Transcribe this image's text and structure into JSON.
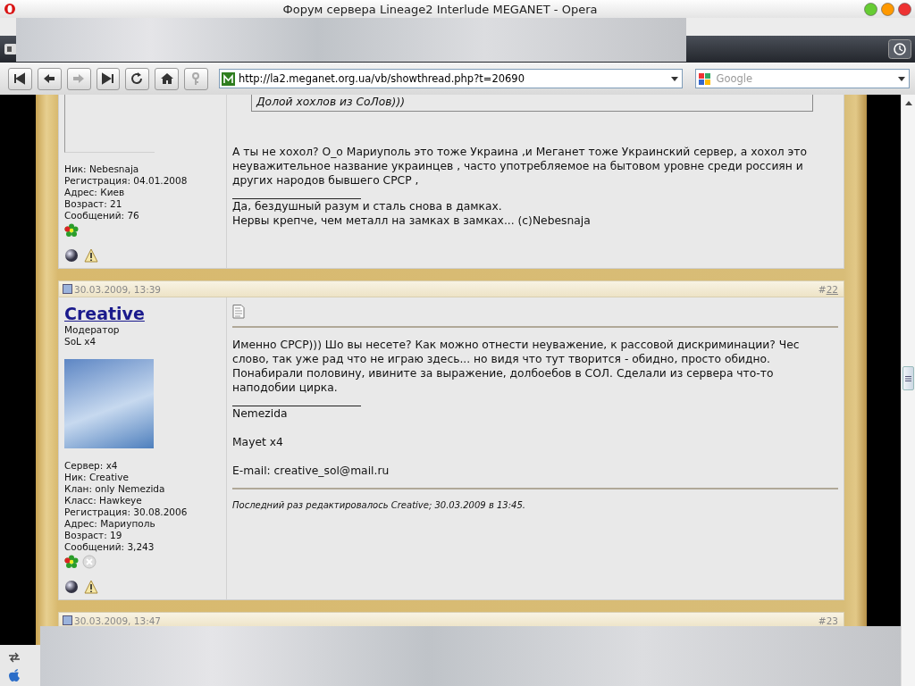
{
  "window": {
    "title": "Форум сервера Lineage2 Interlude MEGANET - Opera"
  },
  "toolbar": {
    "address": "http://la2.meganet.org.ua/vb/showthread.php?t=20690",
    "search": {
      "placeholder": "Google"
    }
  },
  "posts": [
    {
      "user_info": [
        "Ник: Nebesnaja",
        "Регистрация: 04.01.2008",
        "Адрес: Киев",
        "Возраст: 21",
        "Сообщений: 76"
      ],
      "contacts": [
        {
          "kind": "flower"
        }
      ],
      "quote": "Долой хохлов из СоЛов)))",
      "message": "А ты не хохол? О_о Мариуполь это тоже Украина ,и Меганет тоже Украинский сервер, а хохол это неуважительное название украинцев , часто употребляемое на бытовом уровне среди россиян и других народов бывшего СРСР ,",
      "signature": [
        "Да, бездушный разум и сталь снова в дамках.\nНервы крепче, чем металл на замках в замках... (c)Nebesnaja"
      ]
    },
    {
      "date": "30.03.2009, 13:39",
      "number": {
        "hash": "#",
        "value": "22",
        "link": true
      },
      "username": "Creative",
      "user_title": "Модератор",
      "user_rank": "SoL x4",
      "avatar": true,
      "user_info": [
        "Сервер: x4",
        "Ник: Creative",
        "Клан: only Nemezida",
        "Класс: Hawkeye",
        "Регистрация: 30.08.2006",
        "Адрес: Мариуполь",
        "Возраст: 19",
        "Сообщений: 3,243"
      ],
      "contacts": [
        {
          "kind": "flower"
        },
        {
          "kind": "crossed-circle"
        }
      ],
      "post_icon": true,
      "message": "Именно СРСР))) Шо вы несете? Как можно отнести неуважение, к рассовой дискриминации? Чес слово, так уже рад что не играю здесь... но видя что тут творится - обидно, просто обидно. Понабирали половину, ивините за выражение, долбоебов в СОЛ. Сделали из сервера что-то наподобии цирка.",
      "signature": [
        "Nemezida",
        "Mayet x4",
        "E-mail: creative_sol@mail.ru"
      ],
      "edit_note": "Последний раз редактировалось Creative; 30.03.2009 в 13:45."
    },
    {
      "date": "30.03.2009, 13:47",
      "number": {
        "hash": "#",
        "value": "23",
        "link": false
      }
    }
  ]
}
